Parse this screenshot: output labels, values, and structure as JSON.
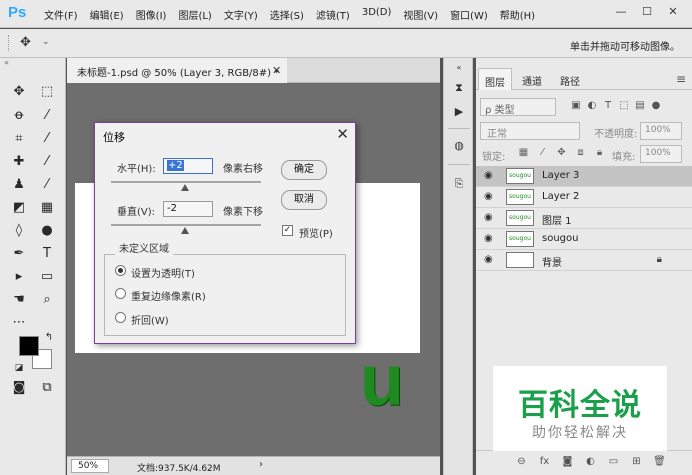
{
  "app": {
    "logo": "Ps"
  },
  "menu": [
    "文件(F)",
    "编辑(E)",
    "图像(I)",
    "图层(L)",
    "文字(Y)",
    "选择(S)",
    "滤镜(T)",
    "3D(D)",
    "视图(V)",
    "窗口(W)",
    "帮助(H)"
  ],
  "window_controls": [
    "—",
    "☐",
    "✕"
  ],
  "options_bar": {
    "hint": "单击并拖动可移动图像。"
  },
  "document": {
    "tab_title": "未标题-1.psd @ 50% (Layer 3, RGB/8#) *",
    "canvas_text": "u",
    "zoom": "50%",
    "doc_info": "文档:937.5K/4.62M"
  },
  "layers_panel": {
    "tabs": [
      "图层",
      "通道",
      "路径"
    ],
    "kind_placeholder": "ρ 类型",
    "blend_mode": "正常",
    "opacity_label": "不透明度:",
    "opacity_value": "100%",
    "lock_label": "锁定:",
    "fill_label": "填充:",
    "fill_value": "100%",
    "layers": [
      {
        "name": "Layer 3",
        "thumb": "sougou",
        "selected": true,
        "locked": false
      },
      {
        "name": "Layer 2",
        "thumb": "sougou",
        "selected": false,
        "locked": false
      },
      {
        "name": "图层 1",
        "thumb": "sougou",
        "selected": false,
        "locked": false
      },
      {
        "name": "sougou",
        "thumb": "sougou",
        "selected": false,
        "locked": false
      },
      {
        "name": "背景",
        "thumb": "",
        "selected": false,
        "locked": true
      }
    ]
  },
  "dialog": {
    "title": "位移",
    "horizontal_label": "水平(H):",
    "horizontal_value": "+2",
    "horizontal_unit": "像素右移",
    "vertical_label": "垂直(V):",
    "vertical_value": "-2",
    "vertical_unit": "像素下移",
    "ok_label": "确定",
    "cancel_label": "取消",
    "preview_label": "预览(P)",
    "preview_checked": true,
    "undefined_area_title": "未定义区域",
    "options": [
      {
        "label": "设置为透明(T)",
        "selected": true
      },
      {
        "label": "重复边缘像素(R)",
        "selected": false
      },
      {
        "label": "折回(W)",
        "selected": false
      }
    ]
  },
  "watermark": {
    "title": "百科全说",
    "subtitle": "助你轻松解决"
  },
  "colors": {
    "accent_ps": "#31a8ff",
    "dialog_border": "#7b3f99",
    "canvas_text": "#1f8a1f",
    "watermark_green": "#1aa04a"
  }
}
